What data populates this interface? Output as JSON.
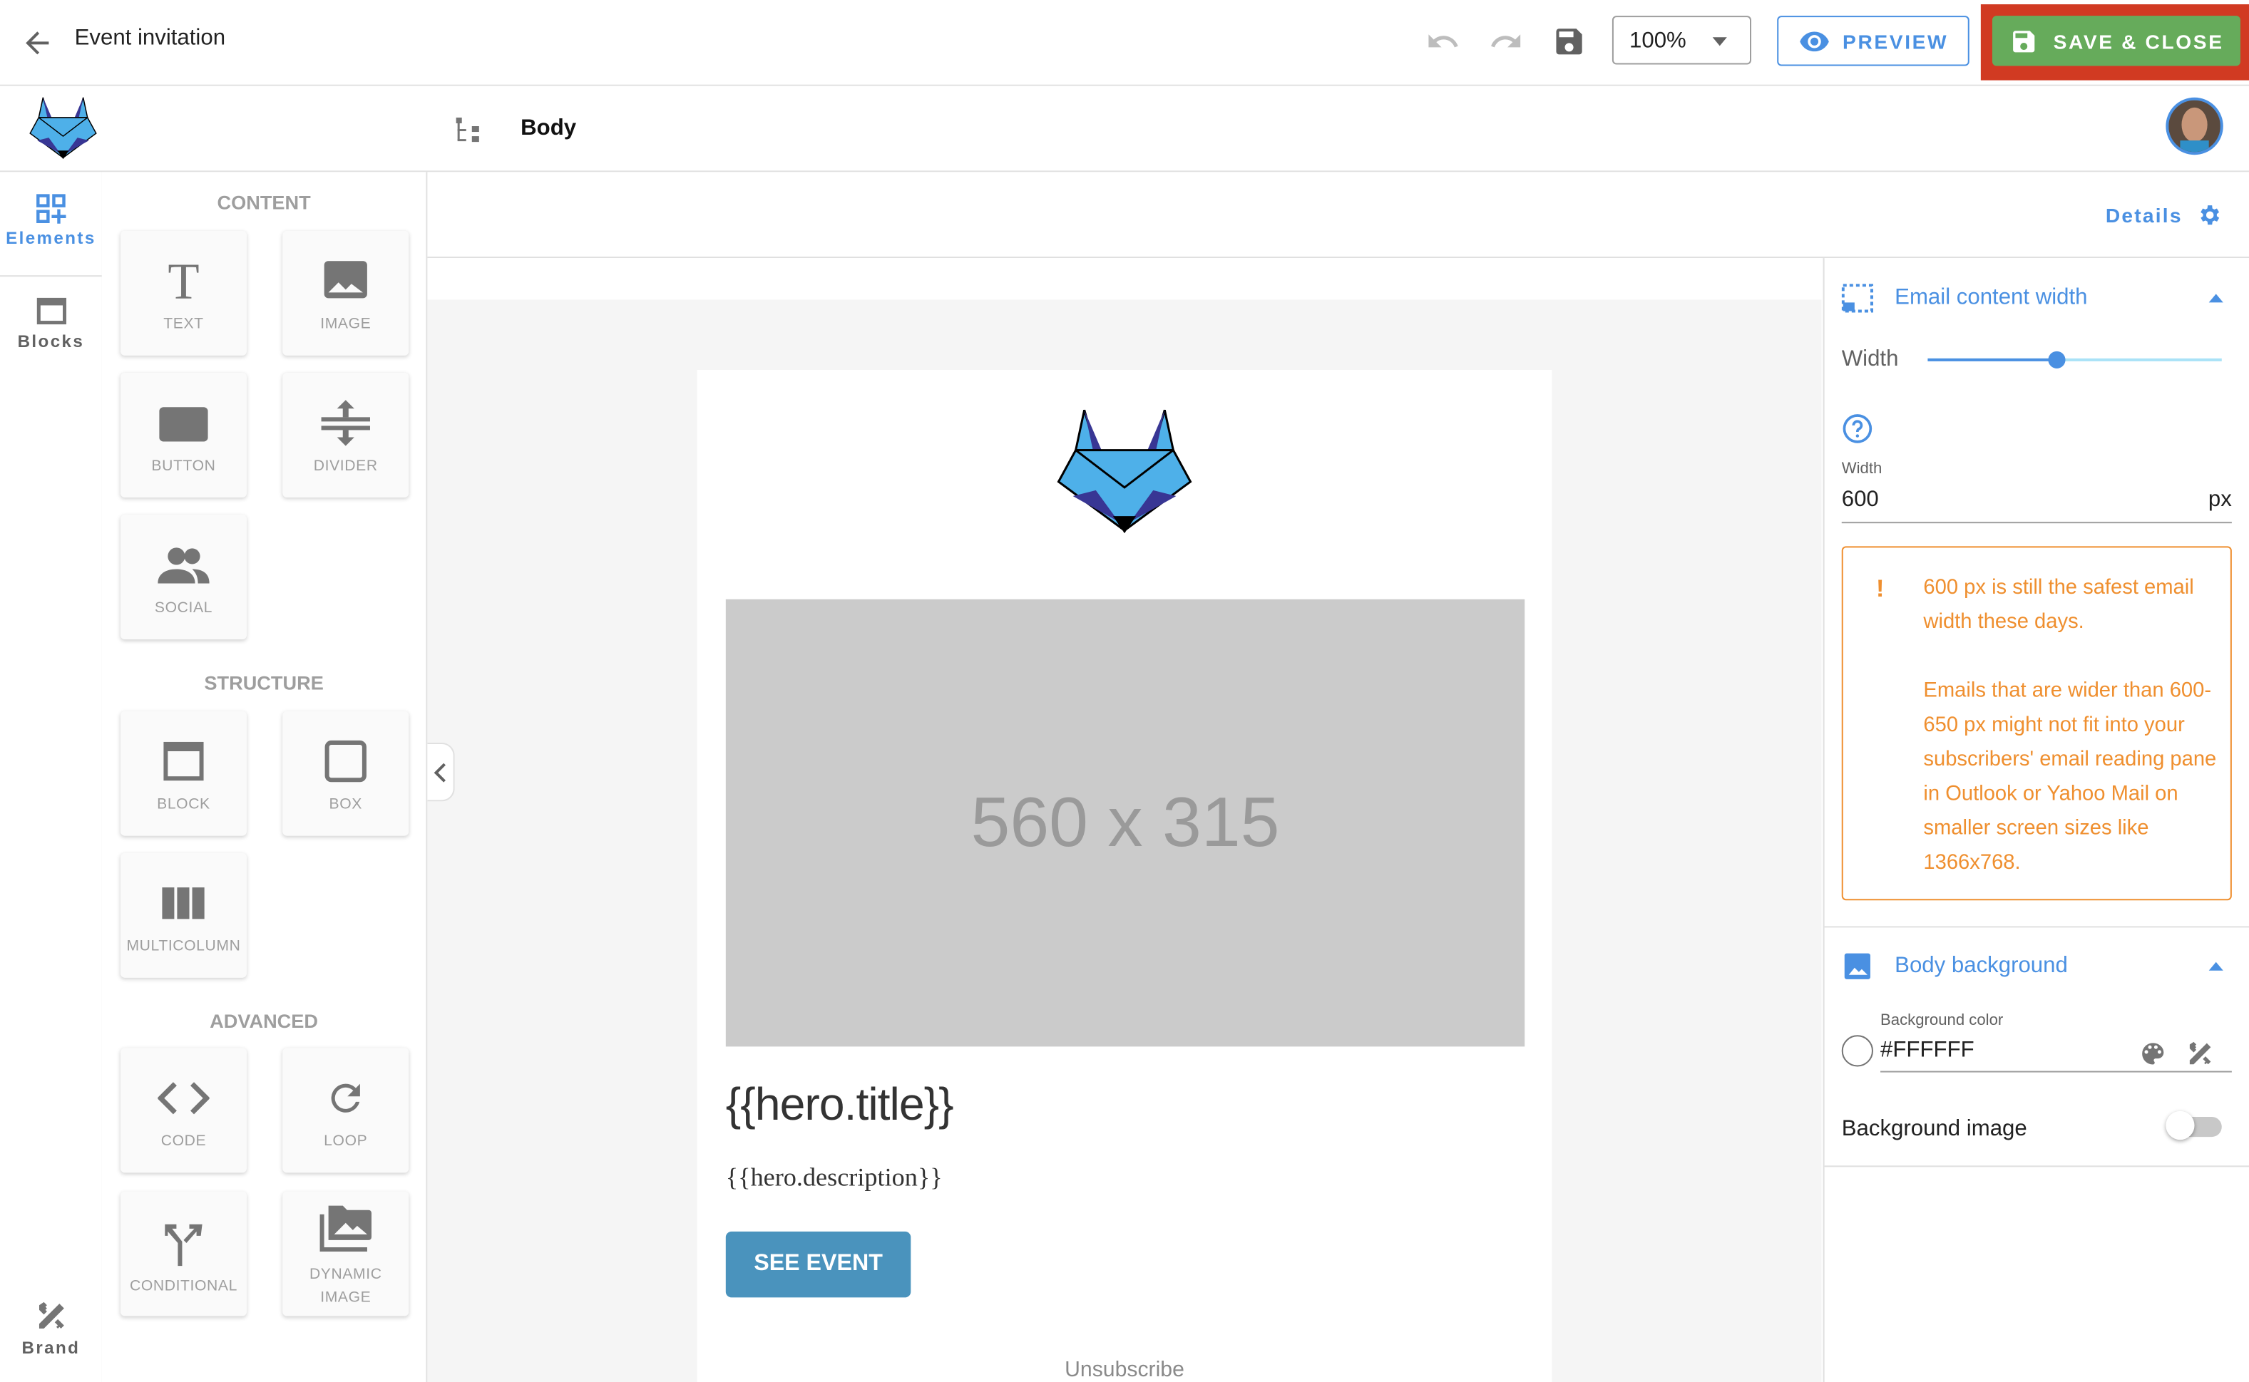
{
  "topbar": {
    "title": "Event invitation",
    "zoom_value": "100%",
    "preview_label": "PREVIEW",
    "save_close_label": "SAVE & CLOSE"
  },
  "subbar": {
    "breadcrumb": "Body"
  },
  "rail": {
    "items": [
      {
        "label": "Elements",
        "active": true
      },
      {
        "label": "Blocks",
        "active": false
      }
    ],
    "bottom_label": "Brand"
  },
  "elements_panel": {
    "sections": [
      {
        "title": "CONTENT",
        "items": [
          "TEXT",
          "IMAGE",
          "BUTTON",
          "DIVIDER",
          "SOCIAL"
        ]
      },
      {
        "title": "STRUCTURE",
        "items": [
          "BLOCK",
          "BOX",
          "MULTICOLUMN"
        ]
      },
      {
        "title": "ADVANCED",
        "items": [
          "CODE",
          "LOOP",
          "CONDITIONAL",
          "DYNAMIC IMAGE"
        ]
      }
    ]
  },
  "canvas": {
    "details_label": "Details",
    "placeholder_image_text": "560 x 315",
    "hero_title": "{{hero.title}}",
    "hero_description": "{{hero.description}}",
    "cta_label": "SEE EVENT",
    "unsubscribe_label": "Unsubscribe"
  },
  "settings": {
    "content_width": {
      "title": "Email content width",
      "slider_label": "Width",
      "slider_value_fraction": 0.44,
      "field_label": "Width",
      "field_value": "600",
      "unit": "px",
      "warning_line1": "600 px is still the safest email width these days.",
      "warning_line2": "Emails that are wider than 600-650 px might not fit into your subscribers' email reading pane in Outlook or Yahoo Mail on smaller screen sizes like 1366x768."
    },
    "body_background": {
      "title": "Body background",
      "color_label": "Background color",
      "color_value": "#FFFFFF",
      "image_label": "Background image",
      "image_enabled": false
    }
  },
  "colors": {
    "accent": "#4a90e2",
    "save_green": "#66ab5b",
    "highlight_red": "#d13a22",
    "warning_orange": "#ef8f2f",
    "cta_blue": "#4a93bd"
  }
}
